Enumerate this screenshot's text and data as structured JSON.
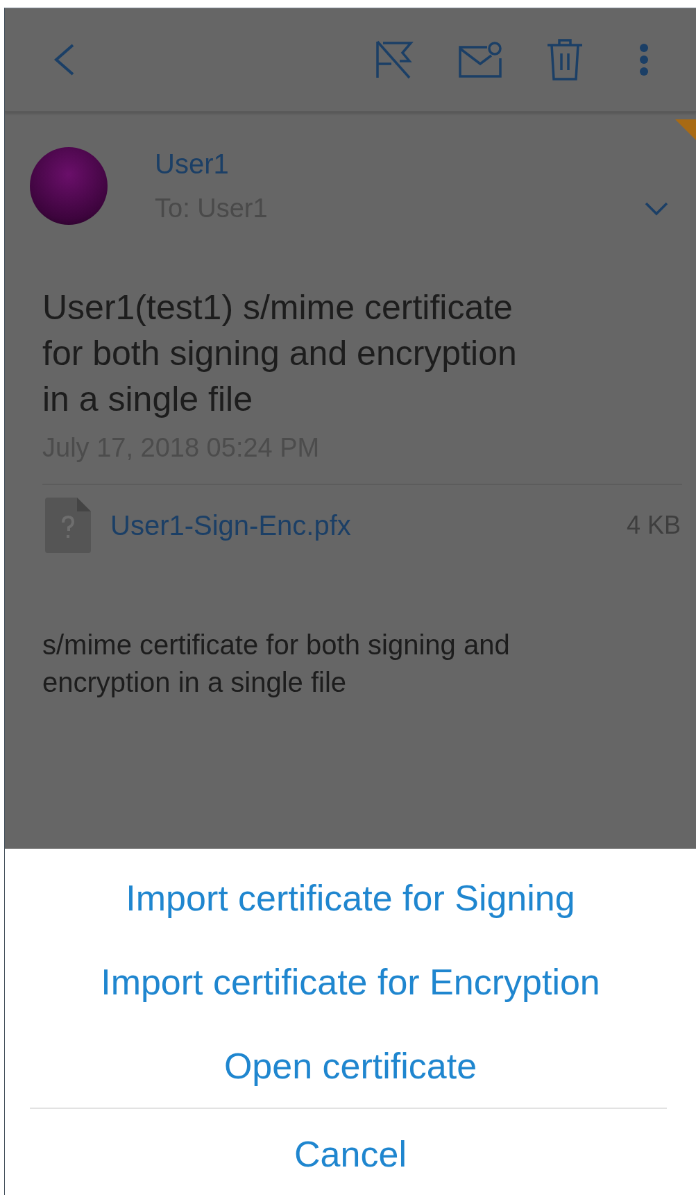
{
  "message": {
    "sender": "User1",
    "recipient": "To: User1",
    "subject": "User1(test1) s/mime certificate for both signing and encryption in a single file",
    "date": "July 17, 2018 05:24 PM",
    "attachment": {
      "name": "User1-Sign-Enc.pfx",
      "size": "4 KB"
    },
    "body": "s/mime certificate for both signing and encryption in a single file"
  },
  "action_sheet": {
    "options": [
      {
        "label": "Import certificate for Signing",
        "kind": "action"
      },
      {
        "label": "Import certificate for Encryption",
        "kind": "action"
      },
      {
        "label": "Open certificate",
        "kind": "action"
      },
      {
        "label": "Cancel",
        "kind": "cancel"
      }
    ]
  }
}
